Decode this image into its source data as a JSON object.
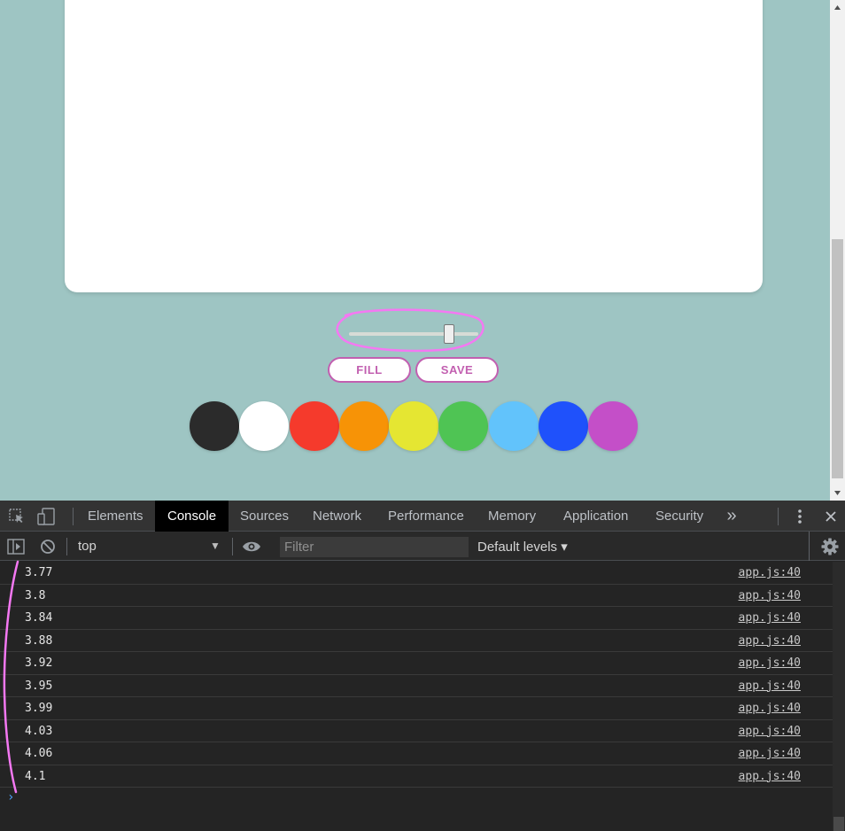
{
  "page": {
    "buttons": {
      "fill_label": "FILL",
      "save_label": "SAVE"
    },
    "slider": {
      "value_fraction": 0.78
    },
    "palette": [
      {
        "name": "black",
        "color": "#2b2b2b"
      },
      {
        "name": "white",
        "color": "#ffffff"
      },
      {
        "name": "red",
        "color": "#f53a2c"
      },
      {
        "name": "orange",
        "color": "#f79306"
      },
      {
        "name": "yellow",
        "color": "#e5e632"
      },
      {
        "name": "green",
        "color": "#4fc454"
      },
      {
        "name": "light-blue",
        "color": "#62c3fb"
      },
      {
        "name": "blue",
        "color": "#1f51fb"
      },
      {
        "name": "purple",
        "color": "#c44fc8"
      }
    ],
    "annotation_color": "#f478f2"
  },
  "devtools": {
    "tabs": [
      "Elements",
      "Console",
      "Sources",
      "Network",
      "Performance",
      "Memory",
      "Application",
      "Security"
    ],
    "active_tab": "Console",
    "more_tabs_glyph": "»",
    "context": "top",
    "filter_placeholder": "Filter",
    "levels": "Default levels ▾",
    "log": [
      {
        "msg": "3.77",
        "src": "app.js:40"
      },
      {
        "msg": "3.8",
        "src": "app.js:40"
      },
      {
        "msg": "3.84",
        "src": "app.js:40"
      },
      {
        "msg": "3.88",
        "src": "app.js:40"
      },
      {
        "msg": "3.92",
        "src": "app.js:40"
      },
      {
        "msg": "3.95",
        "src": "app.js:40"
      },
      {
        "msg": "3.99",
        "src": "app.js:40"
      },
      {
        "msg": "4.03",
        "src": "app.js:40"
      },
      {
        "msg": "4.06",
        "src": "app.js:40"
      },
      {
        "msg": "4.1",
        "src": "app.js:40"
      }
    ],
    "prompt": "›"
  }
}
